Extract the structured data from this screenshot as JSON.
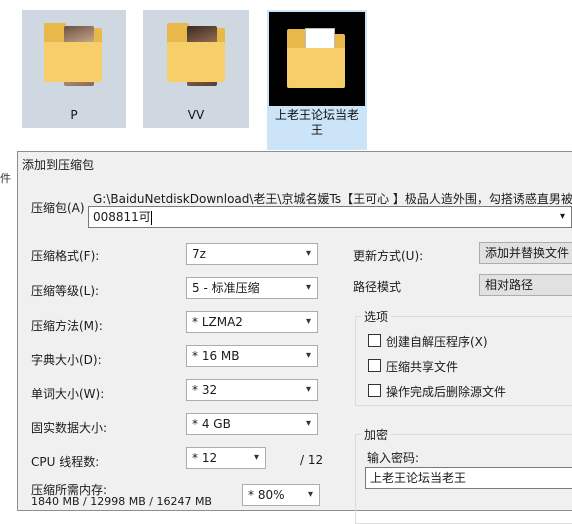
{
  "explorer": {
    "folders": [
      {
        "name": "P"
      },
      {
        "name": "VV"
      },
      {
        "name": "上老王论坛当老王",
        "selected": true
      }
    ]
  },
  "dialog": {
    "title": "添加到压缩包",
    "archive_label": "压缩包(A)",
    "archive_path": "G:\\BaiduNetdiskDownload\\老王\\京城名媛Ts【王可心 】极品人造外围，勾搭诱惑直男被一顿偷",
    "archive_name_value": "008811可",
    "left_fields": [
      {
        "label": "压缩格式(F):",
        "value": "7z"
      },
      {
        "label": "压缩等级(L):",
        "value": "5 - 标准压缩"
      },
      {
        "label": "压缩方法(M):",
        "value": "* LZMA2"
      },
      {
        "label": "字典大小(D):",
        "value": "* 16 MB"
      },
      {
        "label": "单词大小(W):",
        "value": "* 32"
      },
      {
        "label": "固实数据大小:",
        "value": "* 4 GB"
      }
    ],
    "cpu_label": "CPU 线程数:",
    "cpu_value": "* 12",
    "cpu_total": "/ 12",
    "memory_label": "压缩所需内存:",
    "memory_sub": "1840 MB / 12998 MB / 16247 MB",
    "memory_value": "* 80%",
    "update_label": "更新方式(U):",
    "update_value": "添加并替换文件",
    "path_label": "路径模式",
    "path_value": "相对路径",
    "options_title": "选项",
    "options": [
      {
        "label": "创建自解压程序(X)"
      },
      {
        "label": "压缩共享文件"
      },
      {
        "label": "操作完成后删除源文件"
      }
    ],
    "encrypt_title": "加密",
    "password_label": "输入密码:",
    "password_value": "上老王论坛当老王"
  },
  "colors": {
    "folder": "#f6cf6b",
    "tile_bg": "#cfd8e0",
    "selected_bg": "#cce4f7",
    "dialog_bg": "#f0f0f0"
  }
}
